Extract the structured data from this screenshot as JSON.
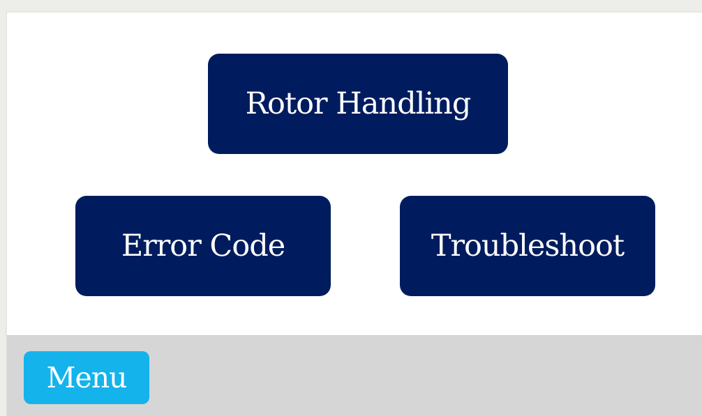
{
  "main": {
    "buttons": {
      "rotor_handling": "Rotor Handling",
      "error_code": "Error Code",
      "troubleshoot": "Troubleshoot"
    }
  },
  "footer": {
    "menu_label": "Menu"
  },
  "colors": {
    "primary_button": "#001c5e",
    "menu_button": "#14b3ec",
    "footer_bar": "#d6d6d6",
    "content_background": "#ffffff"
  }
}
